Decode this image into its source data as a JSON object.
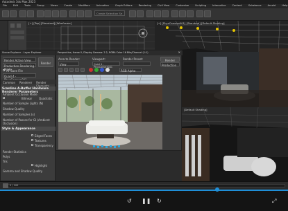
{
  "app": {
    "title": "Autodesk 3ds Max 2023"
  },
  "menu": [
    "File",
    "Edit",
    "Tools",
    "Group",
    "Views",
    "Create",
    "Modifiers",
    "Animation",
    "Graph Editors",
    "Rendering",
    "Civil View",
    "Customize",
    "Scripting",
    "Interactive",
    "Content",
    "Substance",
    "Arnold",
    "Help"
  ],
  "toolbar": {
    "selection_set_placeholder": "Create Selection Se"
  },
  "viewports": {
    "top_label": "[+] [Top] [Standard] [Wireframe]",
    "persp_label": "[+] [PhysCamera001] [Standard] [Default Shading]",
    "br_label": "[Default Shading]"
  },
  "explorer": {
    "title": "Scene Explorer - Layer Explorer",
    "rows": [
      "Render Active View",
      "Production Rendering Mode"
    ],
    "render_button": "Render",
    "option_label": "AT Save File",
    "camera_label": "Quad 4 - PhysCamera001"
  },
  "panel": {
    "tabs": [
      "Common",
      "Renderer",
      "Render Elements"
    ],
    "section1": "Scanline A-Buffer Hardware Renderer Parameters",
    "rows": [
      "Ambient Occlusion Mode",
      "Number of Sample Lights (N)",
      "Shadow Quality",
      "Number of Samples (x)",
      "Number of Passes for GI (Ambient Occlusion)"
    ],
    "mode_a": "Bilinear",
    "mode_b": "Quadratic",
    "section2": "Style & Appearance",
    "check_labels": [
      "Edged Faces",
      "Textures",
      "Transparency"
    ],
    "section3": "Render Statistics",
    "stat_rows": [
      "Polys",
      "Tris",
      "Edges",
      "Verts"
    ],
    "highlight_label": "Highlight",
    "footer": "Gamma and Shadow Quality"
  },
  "render_window": {
    "title": "Perspective, frame 0, Display Gamma: 2.2, RGBA Color 16 Bits/Channel (1:1)",
    "area_label": "Area to Render:",
    "area_value": "View",
    "viewport_label": "Viewport:",
    "viewport_value": "Quad 4 - PhysCamera001",
    "preset_label": "Render Preset:",
    "preset_value": "",
    "render_button": "Render",
    "production_value": "Production",
    "channel_value": "RGB Alpha"
  },
  "timeline": {
    "frame": "0 / 100"
  },
  "colors": {
    "accent": "#1f8fd8",
    "viewport_active": "#e5c400",
    "bg": "#2b2b2b"
  }
}
